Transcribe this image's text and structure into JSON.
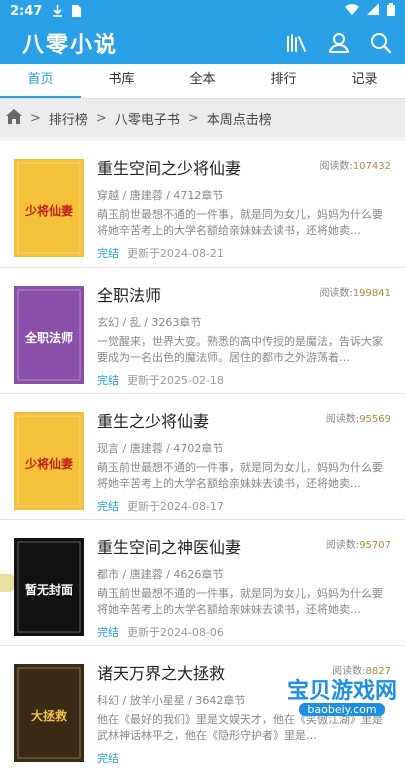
{
  "status_bar": {
    "time": "2:47"
  },
  "app": {
    "logo": "八零小说"
  },
  "tabs": [
    {
      "label": "首页"
    },
    {
      "label": "书库"
    },
    {
      "label": "全本"
    },
    {
      "label": "排行"
    },
    {
      "label": "记录"
    }
  ],
  "breadcrumb": {
    "items": [
      "排行榜",
      "八零电子书",
      "本周点击榜"
    ]
  },
  "reads_label": "阅读数:",
  "books": [
    {
      "title": "重生空间之少将仙妻",
      "reads": "107432",
      "category": "穿越",
      "author": "唐建蓉",
      "chapters": "4712章节",
      "desc": "萌玉前世最想不通的一件事，就是同为女儿，妈妈为什么要将她辛苦考上的大学名额给亲妹妹去读书，还将她卖…",
      "status": "完结",
      "updated": "更新于2024-08-21"
    },
    {
      "title": "全职法师",
      "reads": "199841",
      "category": "玄幻",
      "author": "乱",
      "chapters": "3263章节",
      "desc": "一觉醒来，世界大变。熟悉的高中传授的是魔法，告诉大家要成为一名出色的魔法师。居住的都市之外游荡着…",
      "status": "完结",
      "updated": "更新于2025-02-18"
    },
    {
      "title": "重生之少将仙妻",
      "reads": "95569",
      "category": "现言",
      "author": "唐建蓉",
      "chapters": "4702章节",
      "desc": "萌玉前世最想不通的一件事，就是同为女儿，妈妈为什么要将她辛苦考上的大学名额给亲妹妹去读书，还将她卖…",
      "status": "完结",
      "updated": "更新于2024-08-17"
    },
    {
      "title": "重生空间之神医仙妻",
      "reads": "95707",
      "category": "都市",
      "author": "唐建蓉",
      "chapters": "4626章节",
      "desc": "萌玉前世最想不通的一件事，就是同为女儿，妈妈为什么要将她辛苦考上的大学名额给亲妹妹去读书，还将她卖…",
      "status": "完结",
      "updated": "更新于2024-08-06"
    },
    {
      "title": "诸天万界之大拯救",
      "reads": "8827",
      "category": "科幻",
      "author": "放羊小星星",
      "chapters": "3642章节",
      "desc": "他在《最好的我们》里是文娱天才，他在《笑傲江湖》里是武林神话林平之，他在《隐形守护者》里是…",
      "status": "完结",
      "updated": ""
    }
  ],
  "covers": [
    {
      "label": "少将仙妻",
      "bg": "#f3c23a",
      "fg": "#c0201a"
    },
    {
      "label": "全职法师",
      "bg": "#8a4fa8",
      "fg": "#ffffff"
    },
    {
      "label": "少将仙妻",
      "bg": "#f3c23a",
      "fg": "#c0201a"
    },
    {
      "label": "暂无封面",
      "bg": "#111111",
      "fg": "#ffffff"
    },
    {
      "label": "大拯救",
      "bg": "#3a2a14",
      "fg": "#f2c24a"
    }
  ],
  "watermark": {
    "text": "宝贝游戏网",
    "sub": "baobeiy.com"
  },
  "colors": {
    "primary": "#2aa0e6",
    "reads": "#b08a3e"
  }
}
